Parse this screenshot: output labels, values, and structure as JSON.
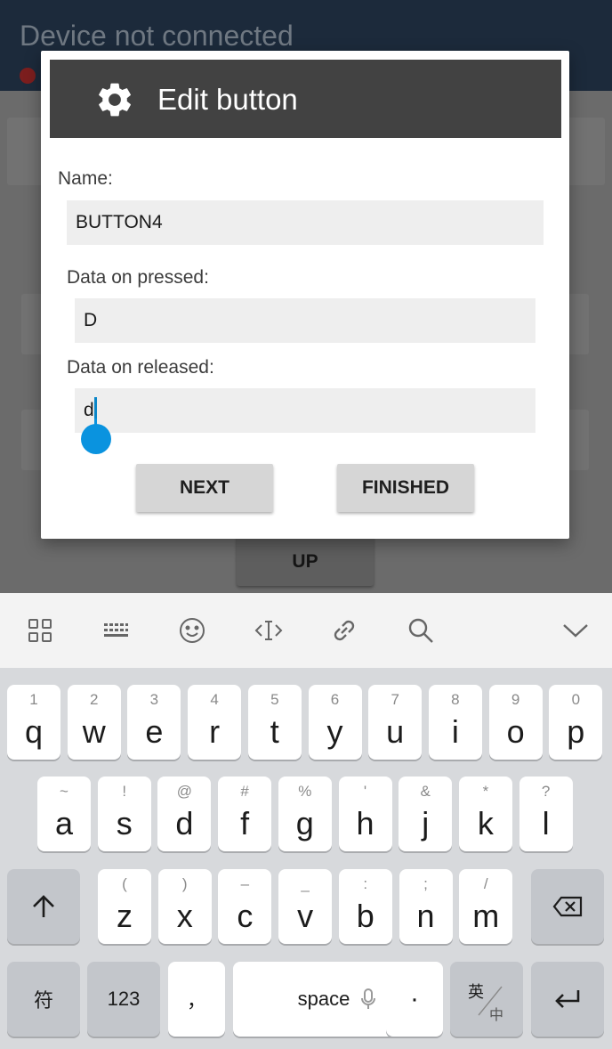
{
  "app": {
    "title": "Device not connected",
    "up_button": "UP"
  },
  "dialog": {
    "title": "Edit button",
    "icon": "gear-icon",
    "fields": {
      "name_label": "Name:",
      "name_value": "BUTTON4",
      "pressed_label": "Data on pressed:",
      "pressed_value": "D",
      "released_label": "Data on released:",
      "released_value": "d"
    },
    "buttons": {
      "next": "NEXT",
      "finished": "FINISHED"
    }
  },
  "keyboard": {
    "toolbar_icons": [
      "grid-icon",
      "keyboard-icon",
      "emoji-icon",
      "text-cursor-icon",
      "link-icon",
      "search-icon",
      "collapse-icon"
    ],
    "row1": [
      {
        "hint": "1",
        "key": "q"
      },
      {
        "hint": "2",
        "key": "w"
      },
      {
        "hint": "3",
        "key": "e"
      },
      {
        "hint": "4",
        "key": "r"
      },
      {
        "hint": "5",
        "key": "t"
      },
      {
        "hint": "6",
        "key": "y"
      },
      {
        "hint": "7",
        "key": "u"
      },
      {
        "hint": "8",
        "key": "i"
      },
      {
        "hint": "9",
        "key": "o"
      },
      {
        "hint": "0",
        "key": "p"
      }
    ],
    "row2": [
      {
        "hint": "~",
        "key": "a"
      },
      {
        "hint": "!",
        "key": "s"
      },
      {
        "hint": "@",
        "key": "d"
      },
      {
        "hint": "#",
        "key": "f"
      },
      {
        "hint": "%",
        "key": "g"
      },
      {
        "hint": "'",
        "key": "h"
      },
      {
        "hint": "&",
        "key": "j"
      },
      {
        "hint": "*",
        "key": "k"
      },
      {
        "hint": "?",
        "key": "l"
      }
    ],
    "row3": [
      {
        "hint": "(",
        "key": "z"
      },
      {
        "hint": ")",
        "key": "x"
      },
      {
        "hint": "–",
        "key": "c"
      },
      {
        "hint": "_",
        "key": "v"
      },
      {
        "hint": ":",
        "key": "b"
      },
      {
        "hint": ";",
        "key": "n"
      },
      {
        "hint": "/",
        "key": "m"
      }
    ],
    "row4": {
      "symbols": "符",
      "numbers": "123",
      "comma": "，",
      "space": "space",
      "period": "·",
      "lang_top": "英",
      "lang_bottom": "中"
    },
    "colors": {
      "accent": "#0a93df",
      "keyboard_bg": "#d7d9dc"
    }
  }
}
